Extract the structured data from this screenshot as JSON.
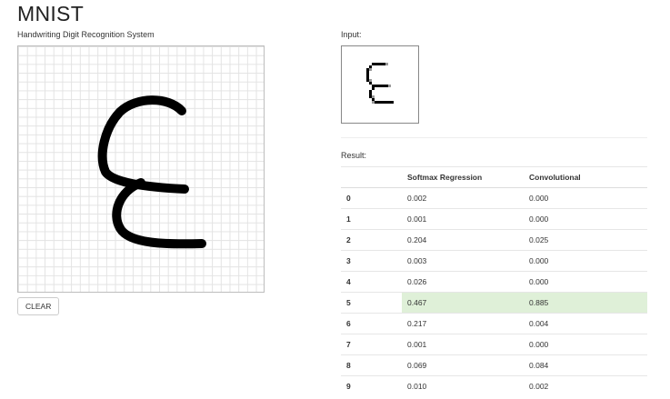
{
  "header": {
    "title": "MNIST",
    "subtitle": "Handwriting Digit Recognition System"
  },
  "canvas": {
    "clear_label": "CLEAR"
  },
  "input": {
    "label": "Input:"
  },
  "results": {
    "label": "Result:",
    "columns": [
      "",
      "Softmax Regression",
      "Convolutional"
    ],
    "highlight_digit": "5",
    "highlight_color": "#dff0d8",
    "rows": [
      {
        "digit": "0",
        "softmax": "0.002",
        "conv": "0.000"
      },
      {
        "digit": "1",
        "softmax": "0.001",
        "conv": "0.000"
      },
      {
        "digit": "2",
        "softmax": "0.204",
        "conv": "0.025"
      },
      {
        "digit": "3",
        "softmax": "0.003",
        "conv": "0.000"
      },
      {
        "digit": "4",
        "softmax": "0.026",
        "conv": "0.000"
      },
      {
        "digit": "5",
        "softmax": "0.467",
        "conv": "0.885"
      },
      {
        "digit": "6",
        "softmax": "0.217",
        "conv": "0.004"
      },
      {
        "digit": "7",
        "softmax": "0.001",
        "conv": "0.000"
      },
      {
        "digit": "8",
        "softmax": "0.069",
        "conv": "0.084"
      },
      {
        "digit": "9",
        "softmax": "0.010",
        "conv": "0.002"
      }
    ]
  }
}
